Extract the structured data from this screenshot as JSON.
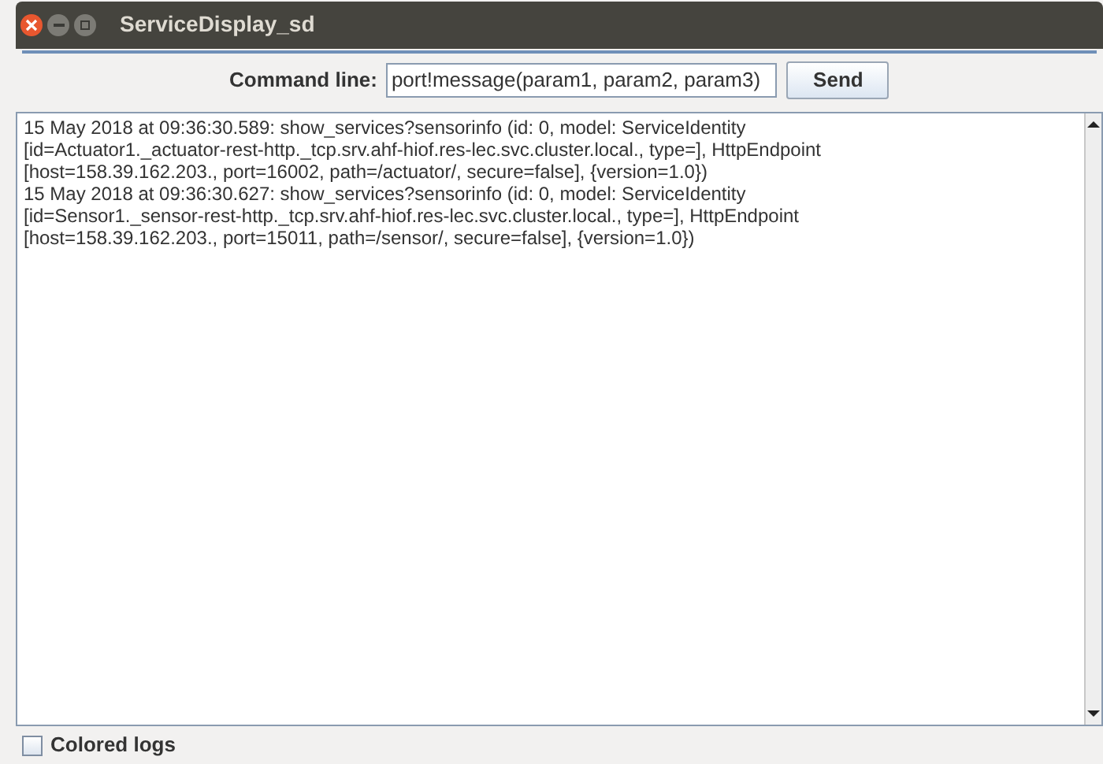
{
  "window": {
    "title": "ServiceDisplay_sd"
  },
  "command": {
    "label": "Command line:",
    "value": "port!message(param1, param2, param3)",
    "button": "Send"
  },
  "log_lines": [
    "15 May 2018 at 09:36:30.589: show_services?sensorinfo (id: 0, model: ServiceIdentity",
    "[id=Actuator1._actuator-rest-http._tcp.srv.ahf-hiof.res-lec.svc.cluster.local., type=], HttpEndpoint",
    "[host=158.39.162.203., port=16002, path=/actuator/, secure=false], {version=1.0})",
    "15 May 2018 at 09:36:30.627: show_services?sensorinfo (id: 0, model: ServiceIdentity",
    "[id=Sensor1._sensor-rest-http._tcp.srv.ahf-hiof.res-lec.svc.cluster.local., type=], HttpEndpoint",
    "[host=158.39.162.203., port=15011, path=/sensor/, secure=false], {version=1.0})"
  ],
  "colored_logs": {
    "label": "Colored logs",
    "checked": false
  }
}
